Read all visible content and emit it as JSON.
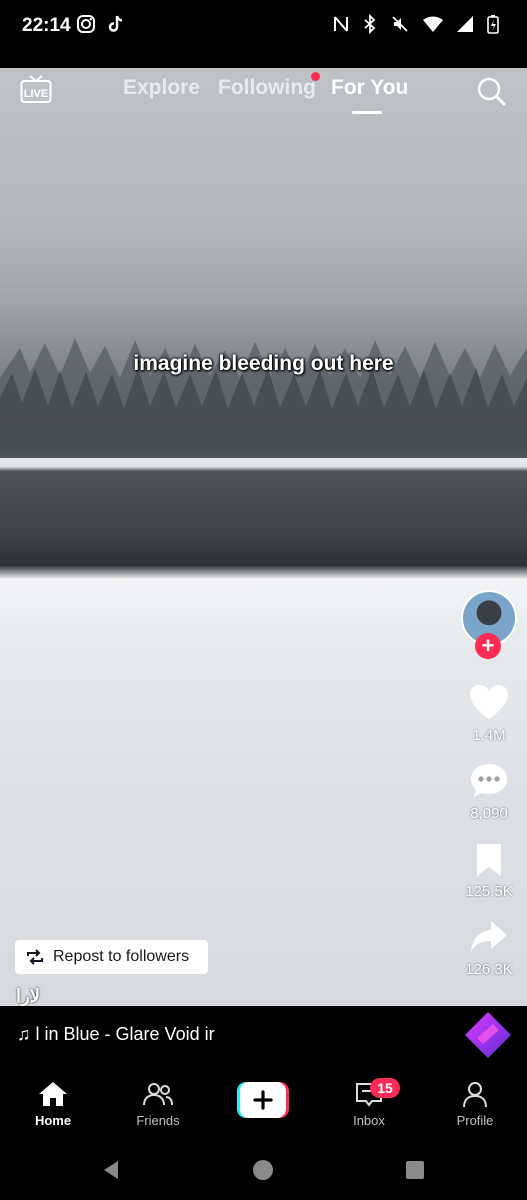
{
  "status_bar": {
    "time": "22:14",
    "left_icons": [
      "instagram-icon",
      "tiktok-icon"
    ],
    "right_icons": [
      "nfc-icon",
      "bluetooth-icon",
      "mute-icon",
      "wifi-icon",
      "signal-icon",
      "battery-icon"
    ]
  },
  "top_nav": {
    "live_label": "LIVE",
    "tabs": [
      {
        "label": "Explore",
        "active": false
      },
      {
        "label": "Following",
        "active": false,
        "has_dot": true
      },
      {
        "label": "For You",
        "active": true
      }
    ]
  },
  "video": {
    "caption_overlay": "imagine bleeding out here"
  },
  "side_actions": {
    "likes": "1.4M",
    "comments": "8,090",
    "bookmarks": "125.5K",
    "shares": "126.3K"
  },
  "repost": {
    "label": "Repost to followers"
  },
  "author": {
    "name": "لارا"
  },
  "music": {
    "text": "♫ l in Blue - Glare    Void ir"
  },
  "bottom_nav": {
    "home": "Home",
    "friends": "Friends",
    "inbox": "Inbox",
    "inbox_badge": "15",
    "profile": "Profile"
  },
  "colors": {
    "accent": "#fe2c55",
    "create_cyan": "#25f4ee"
  }
}
